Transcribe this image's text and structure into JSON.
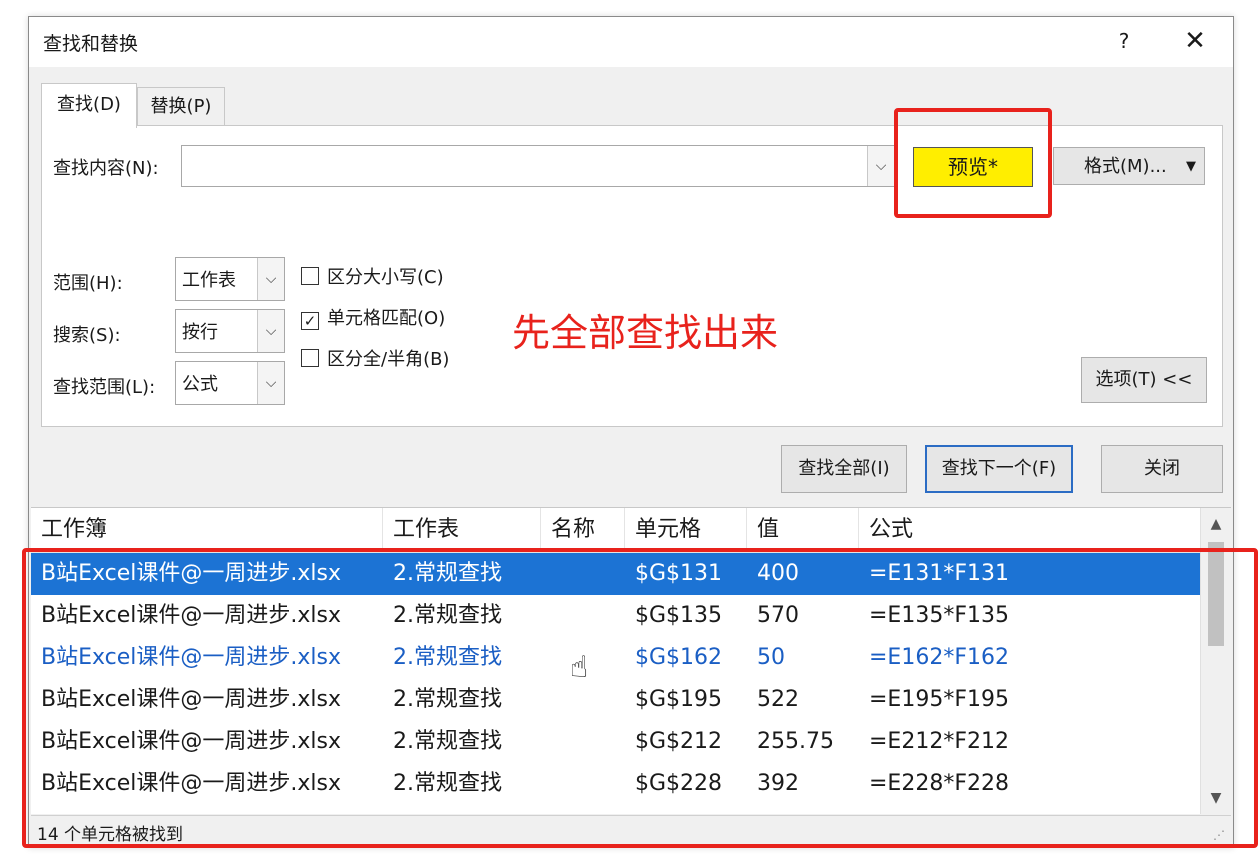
{
  "window": {
    "title": "查找和替换",
    "help_label": "?",
    "close_label": "✕"
  },
  "tabs": [
    {
      "label": "查找(D)"
    },
    {
      "label": "替换(P)"
    }
  ],
  "find": {
    "label": "查找内容(N):",
    "value": "",
    "preview_label": "预览*",
    "format_label": "格式(M)...",
    "preview_bg": "#ffee00"
  },
  "options": {
    "scope_label": "范围(H):",
    "scope_value": "工作表",
    "search_label": "搜索(S):",
    "search_value": "按行",
    "lookin_label": "查找范围(L):",
    "lookin_value": "公式",
    "match_case": {
      "label": "区分大小写(C)",
      "checked": false
    },
    "match_cell": {
      "label": "单元格匹配(O)",
      "checked": true
    },
    "match_width": {
      "label": "区分全/半角(B)",
      "checked": false
    },
    "options_button": "选项(T) <<"
  },
  "annotation": {
    "text": "先全部查找出来",
    "color": "#e8221c"
  },
  "buttons": {
    "find_all": "查找全部(I)",
    "find_next": "查找下一个(F)",
    "close": "关闭"
  },
  "results": {
    "columns": [
      "工作簿",
      "工作表",
      "名称",
      "单元格",
      "值",
      "公式"
    ],
    "rows": [
      {
        "book": "B站Excel课件@一周进步.xlsx",
        "sheet": "2.常规查找",
        "name": "",
        "cell": "$G$131",
        "value": "400",
        "formula": "=E131*F131"
      },
      {
        "book": "B站Excel课件@一周进步.xlsx",
        "sheet": "2.常规查找",
        "name": "",
        "cell": "$G$135",
        "value": "570",
        "formula": "=E135*F135"
      },
      {
        "book": "B站Excel课件@一周进步.xlsx",
        "sheet": "2.常规查找",
        "name": "",
        "cell": "$G$162",
        "value": "50",
        "formula": "=E162*F162"
      },
      {
        "book": "B站Excel课件@一周进步.xlsx",
        "sheet": "2.常规查找",
        "name": "",
        "cell": "$G$195",
        "value": "522",
        "formula": "=E195*F195"
      },
      {
        "book": "B站Excel课件@一周进步.xlsx",
        "sheet": "2.常规查找",
        "name": "",
        "cell": "$G$212",
        "value": "255.75",
        "formula": "=E212*F212"
      },
      {
        "book": "B站Excel课件@一周进步.xlsx",
        "sheet": "2.常规查找",
        "name": "",
        "cell": "$G$228",
        "value": "392",
        "formula": "=E228*F228"
      }
    ],
    "selected_color": "#1c73d4"
  },
  "status": "14 个单元格被找到"
}
